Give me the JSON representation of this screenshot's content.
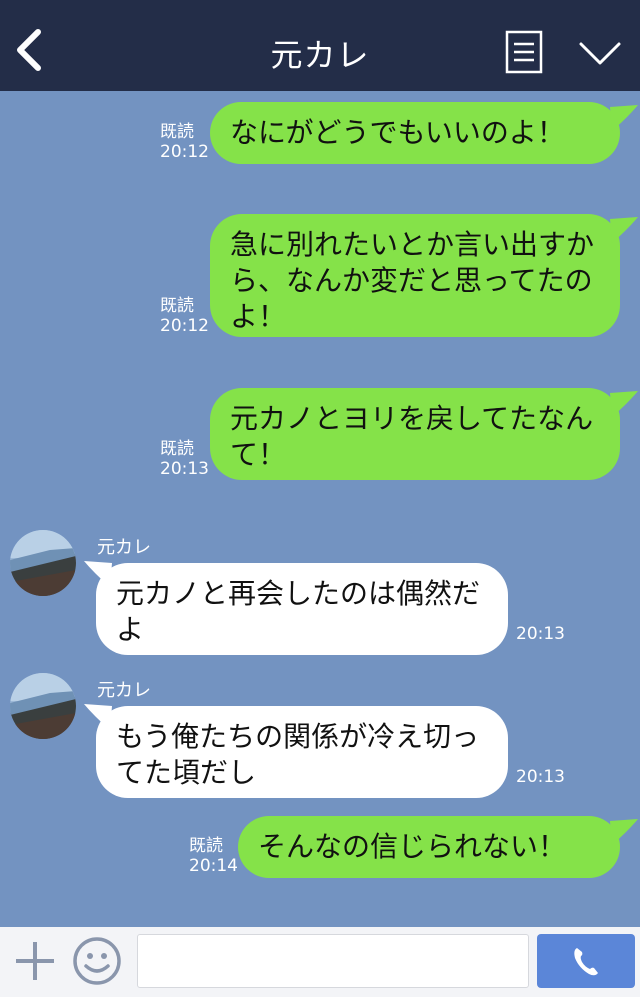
{
  "header": {
    "title": "元カレ"
  },
  "messages": [
    {
      "type": "sent",
      "text": "なにがどうでもいいのよ！",
      "read": "既読",
      "time": "20:12"
    },
    {
      "type": "sent",
      "text": "急に別れたいとか言い出すから、なんか変だと思ってたのよ！",
      "read": "既読",
      "time": "20:12"
    },
    {
      "type": "sent",
      "text": "元カノとヨリを戻してたなんて！",
      "read": "既読",
      "time": "20:13"
    },
    {
      "type": "received",
      "sender": "元カレ",
      "text": "元カノと再会したのは偶然だよ",
      "time": "20:13"
    },
    {
      "type": "received",
      "sender": "元カレ",
      "text": "もう俺たちの関係が冷え切ってた頃だし",
      "time": "20:13"
    },
    {
      "type": "sent",
      "text": "そんなの信じられない！",
      "read": "既読",
      "time": "20:14"
    }
  ],
  "footer": {
    "input_value": ""
  },
  "colors": {
    "header_bg": "#232d48",
    "chat_bg": "#7393c1",
    "sent_bubble": "#85e249",
    "received_bubble": "#ffffff",
    "send_button": "#5b86d8"
  },
  "icons": [
    "back-icon",
    "menu-icon",
    "chevron-down-icon",
    "plus-icon",
    "emoji-icon",
    "phone-icon"
  ]
}
